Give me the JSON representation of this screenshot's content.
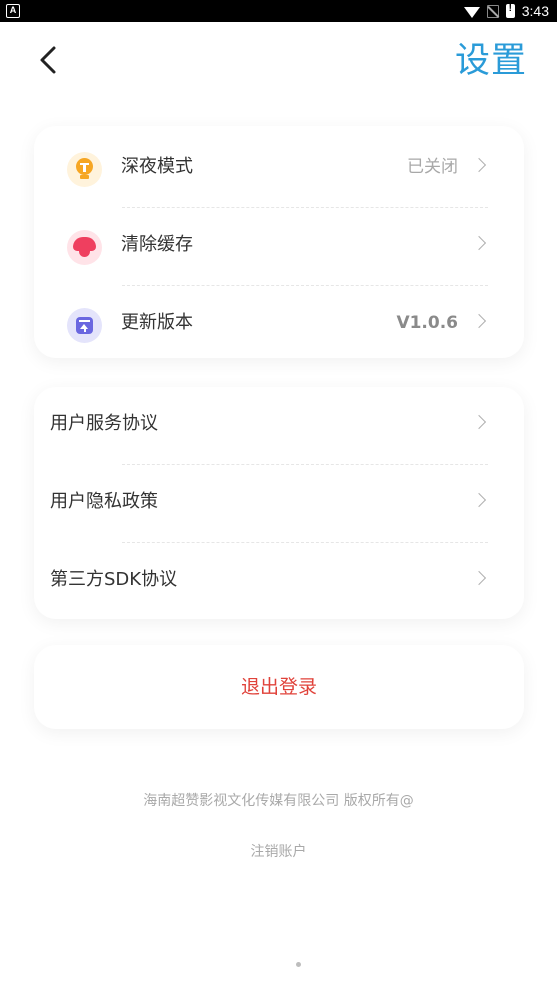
{
  "status_bar": {
    "app_badge": "A",
    "time": "3:43"
  },
  "header": {
    "title": "设置"
  },
  "settings_card": {
    "items": [
      {
        "icon": "lamp-icon",
        "label": "深夜模式",
        "value": "已关闭"
      },
      {
        "icon": "mushroom-cleanup-icon",
        "label": "清除缓存",
        "value": ""
      },
      {
        "icon": "update-icon",
        "label": "更新版本",
        "value": "V1.0.6"
      }
    ]
  },
  "agreements_card": {
    "items": [
      {
        "label": "用户服务协议"
      },
      {
        "label": "用户隐私政策"
      },
      {
        "label": "第三方SDK协议"
      }
    ]
  },
  "logout": {
    "label": "退出登录"
  },
  "footer": {
    "copyright": "海南超赞影视文化传媒有限公司 版权所有@",
    "cancel_account": "注销账户"
  },
  "colors": {
    "accent": "#2a9bd8",
    "logout": "#e0423a"
  }
}
